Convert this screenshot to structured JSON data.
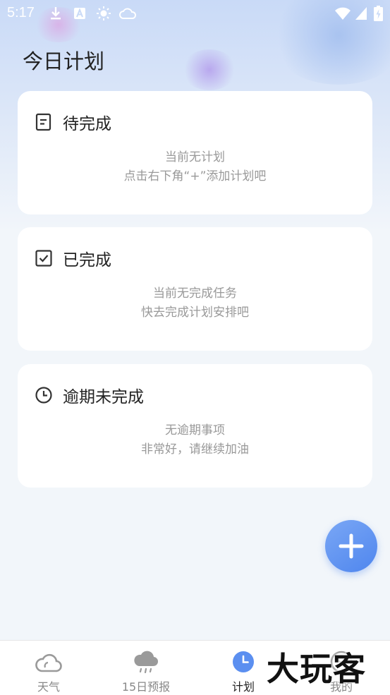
{
  "status_bar": {
    "time": "5:17"
  },
  "page": {
    "title": "今日计划"
  },
  "cards": [
    {
      "title": "待完成",
      "icon": "document-icon",
      "lines": [
        "当前无计划",
        "点击右下角“+”添加计划吧"
      ]
    },
    {
      "title": "已完成",
      "icon": "checkbox-icon",
      "lines": [
        "当前无完成任务",
        "快去完成计划安排吧"
      ]
    },
    {
      "title": "逾期未完成",
      "icon": "clock-icon",
      "lines": [
        "无逾期事项",
        "非常好，请继续加油"
      ]
    }
  ],
  "fab": {
    "icon": "plus-icon"
  },
  "tabs": [
    {
      "label": "天气",
      "icon": "cloud-icon"
    },
    {
      "label": "15日预报",
      "icon": "rain-cloud-icon"
    },
    {
      "label": "计划",
      "icon": "clock-icon",
      "active": true
    },
    {
      "label": "我的",
      "icon": "profile-icon"
    }
  ],
  "watermark": {
    "text": "大玩客"
  },
  "colors": {
    "accent": "#4f86ee",
    "text": "#222222",
    "muted": "#999999"
  }
}
